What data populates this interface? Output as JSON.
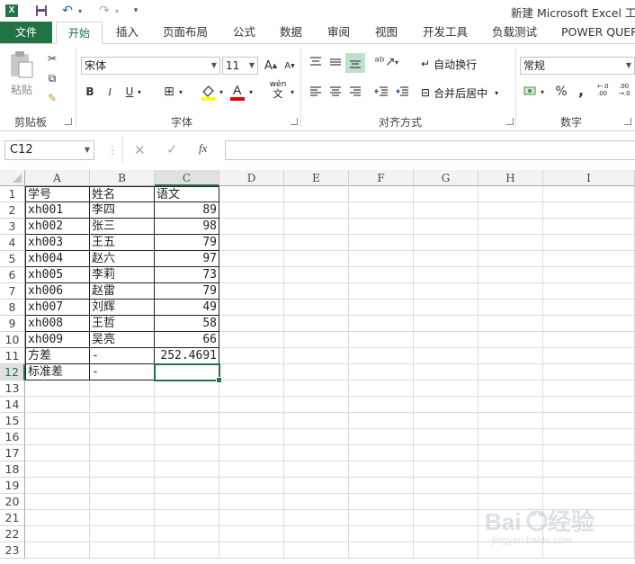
{
  "window": {
    "title": "新建 Microsoft Excel 工作表"
  },
  "qat": {
    "app_icon": "excel-logo",
    "save": "save-icon",
    "undo": "undo-icon",
    "redo": "redo-icon",
    "customize": "customize-qat-icon"
  },
  "tabs": {
    "file": "文件",
    "home": "开始",
    "insert": "插入",
    "layout": "页面布局",
    "formulas": "公式",
    "data": "数据",
    "review": "审阅",
    "view": "视图",
    "developer": "开发工具",
    "loadtest": "负载测试",
    "powerquery": "POWER QUER"
  },
  "ribbon": {
    "clipboard": {
      "paste": "粘贴",
      "label": "剪贴板"
    },
    "font": {
      "name": "宋体",
      "size": "11",
      "label": "字体",
      "bold": "B",
      "italic": "I",
      "underline": "U",
      "grow": "A",
      "shrink": "A",
      "phonetic_top": "wén",
      "phonetic_bottom": "文",
      "font_color": "#ff0000",
      "fill_color": "#ffff00"
    },
    "alignment": {
      "wrap": "自动换行",
      "merge": "合并后居中",
      "label": "对齐方式"
    },
    "number": {
      "format": "常规",
      "label": "数字",
      "percent": "%",
      "comma": ","
    }
  },
  "formula_bar": {
    "name_box": "C12",
    "fx": "fx",
    "value": ""
  },
  "sheet": {
    "columns": [
      "A",
      "B",
      "C",
      "D",
      "E",
      "F",
      "G",
      "H",
      "I"
    ],
    "rows": [
      "1",
      "2",
      "3",
      "4",
      "5",
      "6",
      "7",
      "8",
      "9",
      "10",
      "11",
      "12",
      "13",
      "14",
      "15",
      "16",
      "17",
      "18",
      "19",
      "20",
      "21",
      "22",
      "23"
    ],
    "selected_cell": "C12",
    "data": [
      [
        "学号",
        "姓名",
        "语文"
      ],
      [
        "xh001",
        "李四",
        "89"
      ],
      [
        "xh002",
        "张三",
        "98"
      ],
      [
        "xh003",
        "王五",
        "79"
      ],
      [
        "xh004",
        "赵六",
        "97"
      ],
      [
        "xh005",
        "李莉",
        "73"
      ],
      [
        "xh006",
        "赵雷",
        "79"
      ],
      [
        "xh007",
        "刘辉",
        "49"
      ],
      [
        "xh008",
        "王哲",
        "58"
      ],
      [
        "xh009",
        "吴亮",
        "66"
      ],
      [
        "方差",
        "-",
        "252.4691"
      ],
      [
        "标准差",
        "-",
        ""
      ]
    ]
  },
  "colors": {
    "accent": "#217346",
    "selection": "#217346"
  }
}
